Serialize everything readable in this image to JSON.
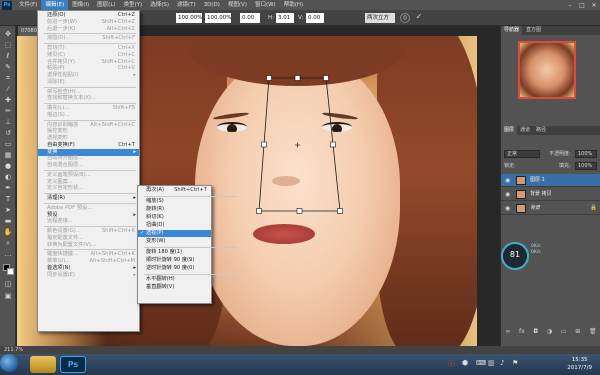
{
  "menubar": {
    "app_logo": "Ps",
    "items": [
      "文件(F)",
      "编辑(E)",
      "图像(I)",
      "图层(L)",
      "类型(Y)",
      "选择(S)",
      "滤镜(T)",
      "3D(D)",
      "视图(V)",
      "窗口(W)",
      "帮助(H)"
    ],
    "active_index": 1,
    "window_controls": [
      "–",
      "□",
      "✕"
    ]
  },
  "options": {
    "width_value": "100.00%",
    "height_value": "100.00%",
    "angle_value": "0.00",
    "h_label": "H:",
    "v_label": "V:",
    "h_value": "3.01",
    "v_value": "0.00",
    "interp_value": "两次立方",
    "cancel_icon": "cancel-icon",
    "commit_icon": "commit-icon"
  },
  "doc_tab": "070803",
  "edit_menu": {
    "items": [
      {
        "label": "还原(O)",
        "shortcut": "Ctrl+Z",
        "disabled": false
      },
      {
        "label": "前进一步(W)",
        "shortcut": "Shift+Ctrl+Z",
        "disabled": true
      },
      {
        "label": "后退一步(K)",
        "shortcut": "Alt+Ctrl+Z",
        "disabled": true
      },
      {
        "sep": true
      },
      {
        "label": "渐隐(D)...",
        "shortcut": "Shift+Ctrl+F",
        "disabled": true
      },
      {
        "sep": true
      },
      {
        "label": "剪切(T)",
        "shortcut": "Ctrl+X",
        "disabled": true
      },
      {
        "label": "拷贝(C)",
        "shortcut": "Ctrl+C",
        "disabled": true
      },
      {
        "label": "合并拷贝(Y)",
        "shortcut": "Shift+Ctrl+C",
        "disabled": true
      },
      {
        "label": "粘贴(P)",
        "shortcut": "Ctrl+V",
        "disabled": true
      },
      {
        "label": "选择性粘贴(I)",
        "shortcut": "",
        "disabled": true,
        "arrow": true
      },
      {
        "label": "清除(E)",
        "shortcut": "",
        "disabled": true
      },
      {
        "sep": true
      },
      {
        "label": "拼写检查(H)...",
        "shortcut": "",
        "disabled": true
      },
      {
        "label": "查找和替换文本(X)...",
        "shortcut": "",
        "disabled": true
      },
      {
        "sep": true
      },
      {
        "label": "填充(L)...",
        "shortcut": "Shift+F5",
        "disabled": true
      },
      {
        "label": "描边(S)...",
        "shortcut": "",
        "disabled": true
      },
      {
        "sep": true
      },
      {
        "label": "内容识别缩放",
        "shortcut": "Alt+Shift+Ctrl+C",
        "disabled": true
      },
      {
        "label": "操控变形",
        "shortcut": "",
        "disabled": true
      },
      {
        "label": "透视变形",
        "shortcut": "",
        "disabled": true
      },
      {
        "label": "自由变换(F)",
        "shortcut": "Ctrl+T",
        "disabled": false
      },
      {
        "label": "变换",
        "shortcut": "",
        "disabled": false,
        "arrow": true,
        "highlight": true
      },
      {
        "label": "自动对齐图层...",
        "shortcut": "",
        "disabled": true
      },
      {
        "label": "自动混合图层...",
        "shortcut": "",
        "disabled": true
      },
      {
        "sep": true
      },
      {
        "label": "定义画笔预设(B)...",
        "shortcut": "",
        "disabled": true
      },
      {
        "label": "定义图案...",
        "shortcut": "",
        "disabled": true
      },
      {
        "label": "定义自定形状...",
        "shortcut": "",
        "disabled": true
      },
      {
        "sep": true
      },
      {
        "label": "清理(R)",
        "shortcut": "",
        "disabled": false,
        "arrow": true
      },
      {
        "sep": true
      },
      {
        "label": "Adobe PDF 预设...",
        "shortcut": "",
        "disabled": true
      },
      {
        "label": "预设",
        "shortcut": "",
        "disabled": false,
        "arrow": true
      },
      {
        "label": "远程连接...",
        "shortcut": "",
        "disabled": true
      },
      {
        "sep": true
      },
      {
        "label": "颜色设置(G)...",
        "shortcut": "Shift+Ctrl+K",
        "disabled": true
      },
      {
        "label": "指定配置文件...",
        "shortcut": "",
        "disabled": true
      },
      {
        "label": "转换为配置文件(V)...",
        "shortcut": "",
        "disabled": true
      },
      {
        "sep": true
      },
      {
        "label": "键盘快捷键...",
        "shortcut": "Alt+Shift+Ctrl+K",
        "disabled": true
      },
      {
        "label": "菜单(U)...",
        "shortcut": "Alt+Shift+Ctrl+M",
        "disabled": true
      },
      {
        "label": "首选项(N)",
        "shortcut": "",
        "disabled": false,
        "arrow": true
      },
      {
        "label": "同步设置(E)",
        "shortcut": "",
        "disabled": true,
        "arrow": true
      }
    ]
  },
  "transform_submenu": {
    "items": [
      {
        "label": "再次(A)",
        "shortcut": "Shift+Ctrl+T"
      },
      {
        "sep": true
      },
      {
        "label": "缩放(S)"
      },
      {
        "label": "旋转(R)"
      },
      {
        "label": "斜切(K)"
      },
      {
        "label": "扭曲(D)"
      },
      {
        "label": "透视(P)",
        "highlight": true,
        "checked": true
      },
      {
        "label": "变形(W)"
      },
      {
        "sep": true
      },
      {
        "label": "旋转 180 度(1)"
      },
      {
        "label": "顺时针旋转 90 度(9)"
      },
      {
        "label": "逆时针旋转 90 度(0)"
      },
      {
        "sep": true
      },
      {
        "label": "水平翻转(H)"
      },
      {
        "label": "垂直翻转(V)"
      }
    ]
  },
  "panels": {
    "nav_tabs": [
      "导航器",
      "直方图"
    ],
    "layers_tabs": [
      "图层",
      "通道",
      "路径"
    ],
    "blend_mode": "正常",
    "opacity_label": "不透明度:",
    "opacity_value": "100%",
    "lock_label": "锁定:",
    "fill_label": "填充:",
    "fill_value": "100%",
    "layers": [
      {
        "name": "图层 1",
        "selected": true
      },
      {
        "name": "背景 拷贝",
        "selected": false
      },
      {
        "name": "背景",
        "selected": false,
        "locked": true
      }
    ],
    "gauge_value": "81",
    "gauge_unit": "%",
    "gauge_stats": [
      "0K/s",
      "0K/s"
    ]
  },
  "status": {
    "zoom": "211.7%"
  },
  "taskbar": {
    "time": "15:35",
    "date": "2017/7/9"
  },
  "colors": {
    "menu_highlight": "#3a87d6",
    "selected_layer": "#3a6fa6",
    "ps_blue": "#35a8f0"
  }
}
